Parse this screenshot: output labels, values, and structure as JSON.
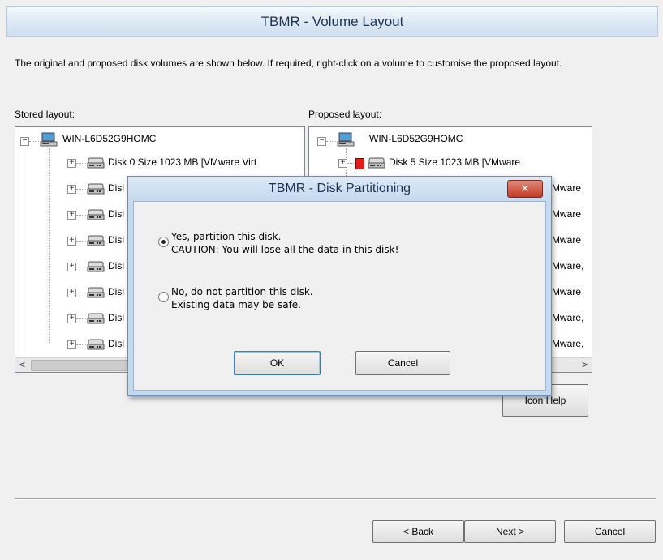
{
  "window": {
    "title": "TBMR - Volume Layout",
    "intro": "The original and proposed disk volumes are shown below. If required, right-click on a volume to customise the proposed layout."
  },
  "stored": {
    "label": "Stored layout:",
    "root": "WIN-L6D52G9HOMC",
    "disks": [
      "Disk 0 Size 1023 MB [VMware Virt",
      "Disl",
      "Disl",
      "Disl",
      "Disl",
      "Disl",
      "Disl",
      "Disl"
    ]
  },
  "proposed": {
    "label": "Proposed layout:",
    "root": "WIN-L6D52G9HOMC",
    "disks": [
      "Disk 5 Size 1023 MB [VMware",
      "Mware",
      "Mware",
      "Mware",
      "Mware,",
      "Mware",
      "Mware,",
      "Mware,"
    ]
  },
  "scroll": {
    "left_arrow": "<",
    "right_arrow": ">"
  },
  "buttons": {
    "icon_help": "Icon Help",
    "back": "< Back",
    "next": "Next >",
    "cancel": "Cancel"
  },
  "dialog": {
    "title": "TBMR - Disk Partitioning",
    "close": "✕",
    "yes_line1": "Yes, partition this disk.",
    "yes_line2": "CAUTION: You will lose all the data in this disk!",
    "no_line1": "No, do not partition this disk.",
    "no_line2": "Existing data may be safe.",
    "selected": "yes",
    "ok": "OK",
    "cancel": "Cancel"
  },
  "colors": {
    "header_bg": "#dbe8f4",
    "dialog_frame": "#c3d9f0",
    "close_button": "#c23a23",
    "warning_badge": "#e21b1b"
  },
  "icons": {
    "root": "computer-icon",
    "disk": "hard-disk-icon",
    "expand": "expand-plus-icon",
    "collapse": "collapse-minus-icon",
    "warning": "warning-badge-icon"
  }
}
